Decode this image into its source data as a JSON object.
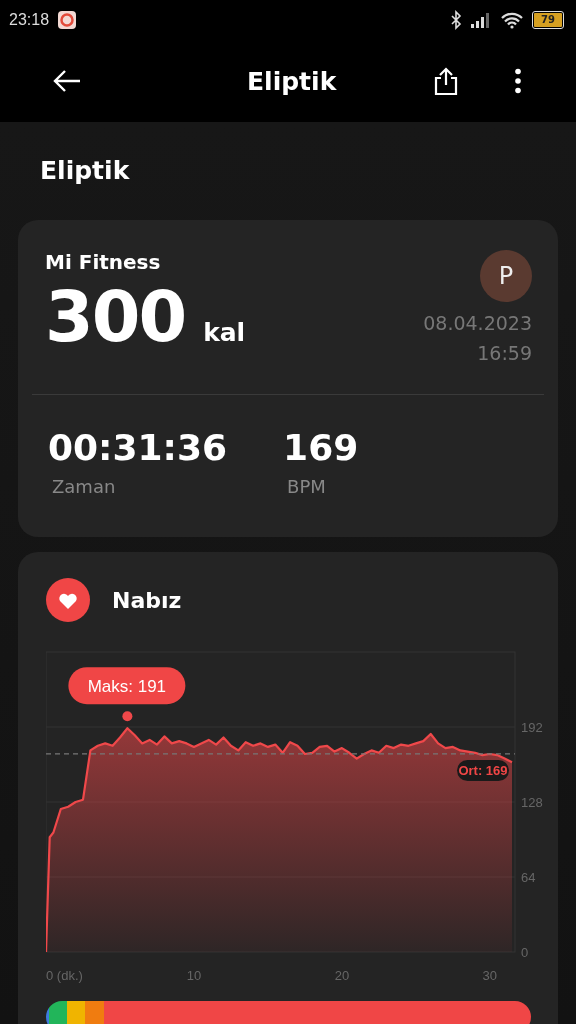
{
  "status_bar": {
    "time": "23:18",
    "battery": "79"
  },
  "header": {
    "title": "Eliptik"
  },
  "workout": {
    "type": "Eliptik"
  },
  "summary": {
    "source": "Mi Fitness",
    "avatar": "P",
    "calories": "300",
    "calories_unit": "kal",
    "date": "08.04.2023",
    "time": "16:59",
    "stats": [
      {
        "value": "00:31:36",
        "label": "Zaman"
      },
      {
        "value": "169",
        "label": "BPM"
      }
    ]
  },
  "heart_rate": {
    "title": "Nabız",
    "chart_data": {
      "type": "area",
      "x": [
        0,
        0.25,
        0.5,
        1,
        1.5,
        2,
        2.5,
        3,
        3.5,
        4,
        4.5,
        5,
        5.5,
        6,
        6.5,
        7,
        7.5,
        8,
        8.5,
        9,
        9.5,
        10,
        10.5,
        11,
        11.5,
        12,
        12.5,
        13,
        13.5,
        14,
        14.5,
        15,
        15.5,
        16,
        16.5,
        17,
        17.5,
        18,
        18.5,
        19,
        19.5,
        20,
        20.5,
        21,
        21.5,
        22,
        22.5,
        23,
        23.5,
        24,
        24.5,
        25,
        25.5,
        26,
        26.5,
        27,
        27.5,
        28,
        28.5,
        29,
        29.5,
        30,
        30.5,
        31,
        31.5
      ],
      "series": [
        {
          "color": "#f0484a",
          "values": [
            0,
            98,
            102,
            122,
            124,
            128,
            130,
            172,
            176,
            178,
            176,
            183,
            191,
            185,
            178,
            181,
            177,
            184,
            178,
            180,
            178,
            175,
            178,
            181,
            177,
            183,
            176,
            172,
            179,
            176,
            178,
            175,
            177,
            170,
            179,
            176,
            169,
            170,
            175,
            176,
            171,
            174,
            170,
            165,
            169,
            172,
            170,
            176,
            174,
            177,
            176,
            178,
            180,
            186,
            178,
            174,
            175,
            172,
            171,
            170,
            168,
            169,
            168,
            165,
            162
          ]
        }
      ],
      "xlim": [
        0,
        31.7
      ],
      "ylim": [
        0,
        256
      ],
      "xticks": [
        {
          "value": 0,
          "label": "0 (dk.)"
        },
        10,
        20,
        30
      ],
      "yticks": [
        0,
        64,
        128,
        192
      ],
      "grid": true,
      "annotations": [
        "Maks: 191"
      ],
      "ref_lines": [
        {
          "axis": "y",
          "value": 169,
          "label": "Ort: 169"
        }
      ]
    },
    "zones": [
      {
        "color": "#3d7be0",
        "level": 0.006
      },
      {
        "color": "#22b55a",
        "level": 0.037
      },
      {
        "color": "#f0b400",
        "level": 0.037
      },
      {
        "color": "#f07c10",
        "level": 0.04
      },
      {
        "color": "#f04646",
        "level": 0.88
      }
    ]
  }
}
